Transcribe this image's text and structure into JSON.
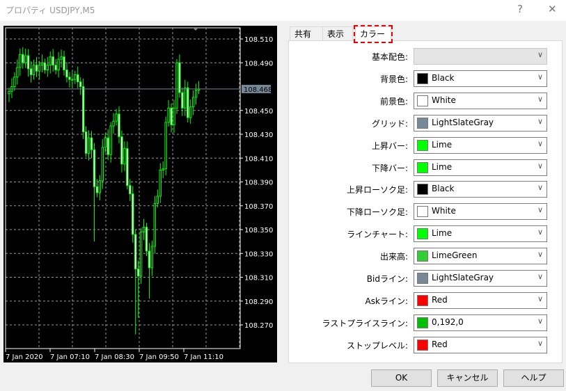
{
  "window": {
    "title": "プロパティ USDJPY,M5",
    "help_icon": "?",
    "close_icon": "✕"
  },
  "tabs": [
    {
      "label": "共有"
    },
    {
      "label": "表示"
    },
    {
      "label": "カラー",
      "selected": true
    }
  ],
  "colors_form": [
    {
      "label": "基本配色:",
      "value": "",
      "swatch": null,
      "disabled": true
    },
    {
      "label": "背景色:",
      "value": "Black",
      "swatch": "#000000"
    },
    {
      "label": "前景色:",
      "value": "White",
      "swatch": "#ffffff"
    },
    {
      "label": "グリッド:",
      "value": "LightSlateGray",
      "swatch": "#778899"
    },
    {
      "label": "上昇バー:",
      "value": "Lime",
      "swatch": "#00ff00"
    },
    {
      "label": "下降バー:",
      "value": "Lime",
      "swatch": "#00ff00"
    },
    {
      "label": "上昇ローソク足:",
      "value": "Black",
      "swatch": "#000000"
    },
    {
      "label": "下降ローソク足:",
      "value": "White",
      "swatch": "#ffffff"
    },
    {
      "label": "ラインチャート:",
      "value": "Lime",
      "swatch": "#00ff00"
    },
    {
      "label": "出来高:",
      "value": "LimeGreen",
      "swatch": "#32cd32"
    },
    {
      "label": "Bidライン:",
      "value": "LightSlateGray",
      "swatch": "#778899"
    },
    {
      "label": "Askライン:",
      "value": "Red",
      "swatch": "#ff0000"
    },
    {
      "label": "ラストプライスライン:",
      "value": "0,192,0",
      "swatch": "#00c000"
    },
    {
      "label": "ストップレベル:",
      "value": "Red",
      "swatch": "#ff0000"
    }
  ],
  "buttons": {
    "ok": "OK",
    "cancel": "キャンセル",
    "help": "ヘルプ"
  },
  "chart_data": {
    "type": "candlestick",
    "symbol": "USDJPY",
    "timeframe": "M5",
    "ylim": [
      108.256,
      108.526
    ],
    "y_ticks": [
      "108.510",
      "108.490",
      "108.450",
      "108.430",
      "108.410",
      "108.390",
      "108.370",
      "108.350",
      "108.330",
      "108.310",
      "108.290",
      "108.270"
    ],
    "x_ticks": [
      "7 Jan 2020",
      "7 Jan 07:10",
      "7 Jan 08:30",
      "7 Jan 09:50",
      "7 Jan 11:10"
    ],
    "bid_price": "108.468",
    "grid": true,
    "bar_color": "#00ff00",
    "bid_line_color": "#778899",
    "grid_color": "#778899",
    "closes": [
      108.466,
      108.47,
      108.478,
      108.486,
      108.497,
      108.49,
      108.496,
      108.485,
      108.48,
      108.488,
      108.483,
      108.488,
      108.49,
      108.484,
      108.488,
      108.495,
      108.488,
      108.484,
      108.493,
      108.495,
      108.484,
      108.478,
      108.476,
      108.476,
      108.48,
      108.474,
      108.47,
      108.432,
      108.414,
      108.427,
      108.417,
      108.386,
      108.381,
      108.391,
      108.419,
      108.427,
      108.413,
      108.437,
      108.441,
      108.447,
      108.428,
      108.405,
      108.418,
      108.387,
      108.38,
      108.346,
      108.317,
      108.311,
      108.348,
      108.352,
      108.332,
      108.318,
      108.336,
      108.372,
      108.378,
      108.4,
      108.401,
      108.44,
      108.452,
      108.438,
      108.452,
      108.49,
      108.465,
      108.452,
      108.469,
      108.444,
      108.453,
      108.461,
      108.467,
      108.468
    ],
    "low_wicks": {
      "31": 108.34,
      "46": 108.262,
      "47": 108.276,
      "51": 108.292
    }
  }
}
